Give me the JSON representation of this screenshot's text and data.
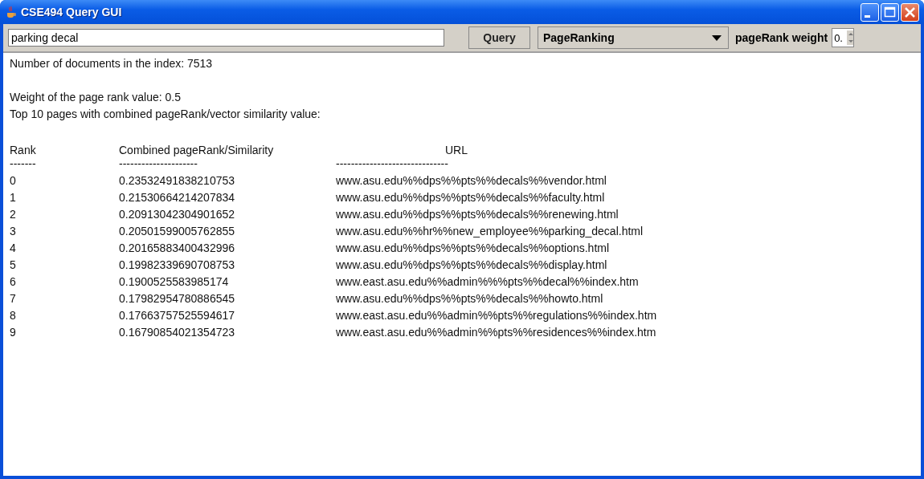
{
  "window": {
    "title": "CSE494 Query GUI"
  },
  "toolbar": {
    "query_field": {
      "value": "parking decal"
    },
    "query_button": "Query",
    "mode_dropdown": {
      "value": "PageRanking"
    },
    "weight_label": "pageRank weight",
    "weight_spinner": {
      "value": "0."
    }
  },
  "output": {
    "paragraphs": [
      [
        "Number of documents in the index: 7513"
      ],
      [
        "Weight of the page rank value: 0.5",
        "Top 10 pages with combined pageRank/vector similarity value:"
      ]
    ],
    "columns": [
      "Rank",
      "Combined pageRank/Similarity",
      "URL"
    ],
    "separators": [
      "-------",
      "---------------------",
      "------------------------------"
    ],
    "rows": [
      {
        "rank": "0",
        "score": "0.23532491838210753",
        "url": "www.asu.edu%%dps%%pts%%decals%%vendor.html"
      },
      {
        "rank": "1",
        "score": "0.21530664214207834",
        "url": "www.asu.edu%%dps%%pts%%decals%%faculty.html"
      },
      {
        "rank": "2",
        "score": "0.20913042304901652",
        "url": "www.asu.edu%%dps%%pts%%decals%%renewing.html"
      },
      {
        "rank": "3",
        "score": "0.20501599005762855",
        "url": "www.asu.edu%%hr%%new_employee%%parking_decal.html"
      },
      {
        "rank": "4",
        "score": "0.20165883400432996",
        "url": "www.asu.edu%%dps%%pts%%decals%%options.html"
      },
      {
        "rank": "5",
        "score": "0.19982339690708753",
        "url": "www.asu.edu%%dps%%pts%%decals%%display.html"
      },
      {
        "rank": "6",
        "score": "0.1900525583985174",
        "url": "www.east.asu.edu%%admin%%%pts%%decal%%index.htm"
      },
      {
        "rank": "7",
        "score": "0.17982954780886545",
        "url": "www.asu.edu%%dps%%pts%%decals%%howto.html"
      },
      {
        "rank": "8",
        "score": "0.17663757525594617",
        "url": "www.east.asu.edu%%admin%%pts%%regulations%%index.htm"
      },
      {
        "rank": "9",
        "score": "0.16790854021354723",
        "url": "www.east.asu.edu%%admin%%pts%%residences%%index.htm"
      }
    ]
  }
}
